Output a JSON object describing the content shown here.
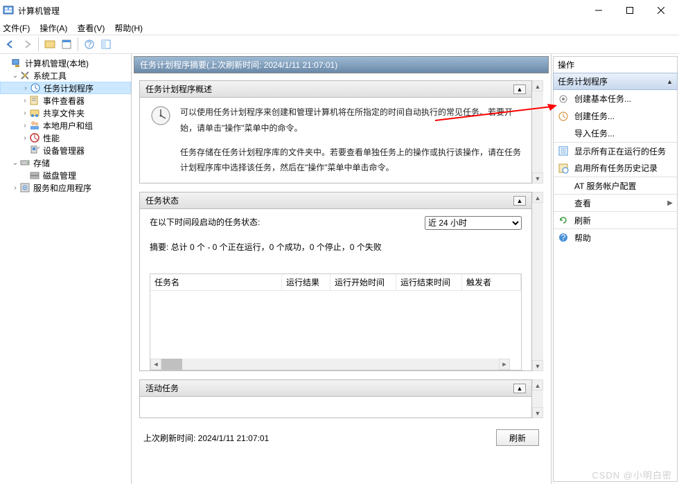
{
  "window": {
    "title": "计算机管理"
  },
  "menu": {
    "file": "文件(F)",
    "action": "操作(A)",
    "view": "查看(V)",
    "help": "帮助(H)"
  },
  "tree": {
    "root": "计算机管理(本地)",
    "sys_tools": "系统工具",
    "task_scheduler": "任务计划程序",
    "event_viewer": "事件查看器",
    "shared_folders": "共享文件夹",
    "local_users": "本地用户和组",
    "performance": "性能",
    "device_mgr": "设备管理器",
    "storage": "存储",
    "disk_mgmt": "磁盘管理",
    "services_apps": "服务和应用程序"
  },
  "center": {
    "header": "任务计划程序摘要(上次刷新时间: 2024/1/11 21:07:01)",
    "overview_title": "任务计划程序概述",
    "overview_p1": "可以使用任务计划程序来创建和管理计算机将在所指定的时间自动执行的常见任务。若要开始，请单击\"操作\"菜单中的命令。",
    "overview_p2": "任务存储在任务计划程序库的文件夹中。若要查看单独任务上的操作或执行该操作，请在任务计划程序库中选择该任务，然后在\"操作\"菜单中单击命令。",
    "status_title": "任务状态",
    "status_label": "在以下时间段启动的任务状态:",
    "period_selected": "近 24 小时",
    "summary": "摘要: 总计 0 个 - 0 个正在运行，0 个成功，0 个停止，0 个失败",
    "cols": {
      "name": "任务名",
      "result": "运行结果",
      "start": "运行开始时间",
      "end": "运行结束时间",
      "trigger": "触发者"
    },
    "active_title": "活动任务",
    "last_refresh": "上次刷新时间: 2024/1/11 21:07:01",
    "refresh_btn": "刷新"
  },
  "actions": {
    "title": "操作",
    "section": "任务计划程序",
    "items": {
      "create_basic": "创建基本任务...",
      "create_task": "创建任务...",
      "import": "导入任务...",
      "show_running": "显示所有正在运行的任务",
      "enable_history": "启用所有任务历史记录",
      "at_account": "AT 服务帐户配置",
      "view": "查看",
      "refresh": "刷新",
      "help": "帮助"
    }
  },
  "watermark": "CSDN @小明白密"
}
